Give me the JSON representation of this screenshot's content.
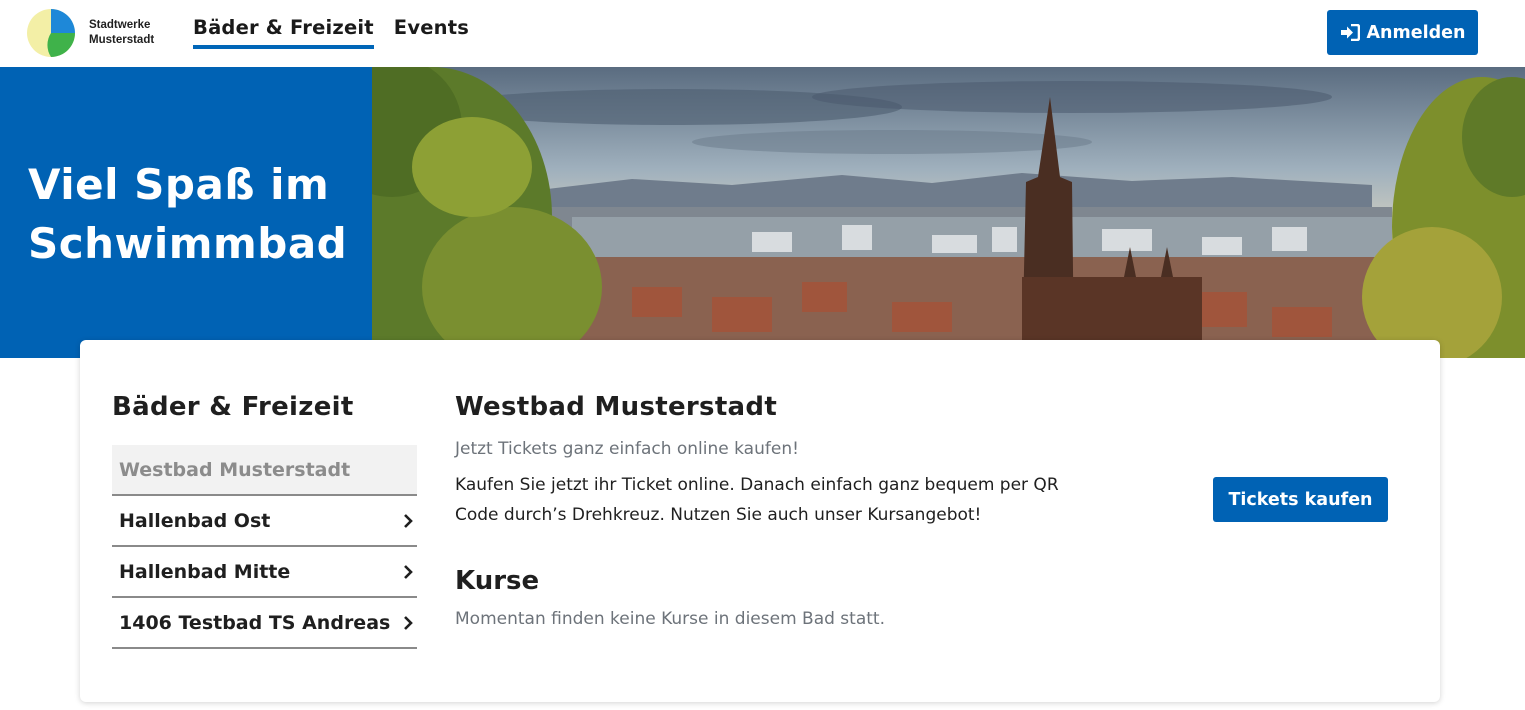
{
  "header": {
    "logo_line1": "Stadtwerke",
    "logo_line2": "Musterstadt",
    "nav": [
      {
        "label": "Bäder & Freizeit",
        "active": true
      },
      {
        "label": "Events",
        "active": false
      }
    ],
    "login_label": "Anmelden",
    "accent": "#0062b4"
  },
  "hero": {
    "title_line1": "Viel Spaß im",
    "title_line2": "Schwimmbad"
  },
  "sidebar": {
    "title": "Bäder & Freizeit",
    "items": [
      {
        "label": "Westbad Musterstadt",
        "active": true
      },
      {
        "label": "Hallenbad Ost",
        "active": false
      },
      {
        "label": "Hallenbad Mitte",
        "active": false
      },
      {
        "label": "1406 Testbad TS Andreas",
        "active": false
      }
    ]
  },
  "main": {
    "title": "Westbad Musterstadt",
    "subtitle": "Jetzt Tickets ganz einfach online kaufen!",
    "description": "Kaufen Sie jetzt ihr Ticket online. Danach einfach ganz bequem per QR Code durch’s Drehkreuz. Nutzen Sie auch unser Kursangebot!",
    "tickets_label": "Tickets kaufen",
    "kurse_title": "Kurse",
    "kurse_text": "Momentan finden keine Kurse in diesem Bad statt."
  }
}
